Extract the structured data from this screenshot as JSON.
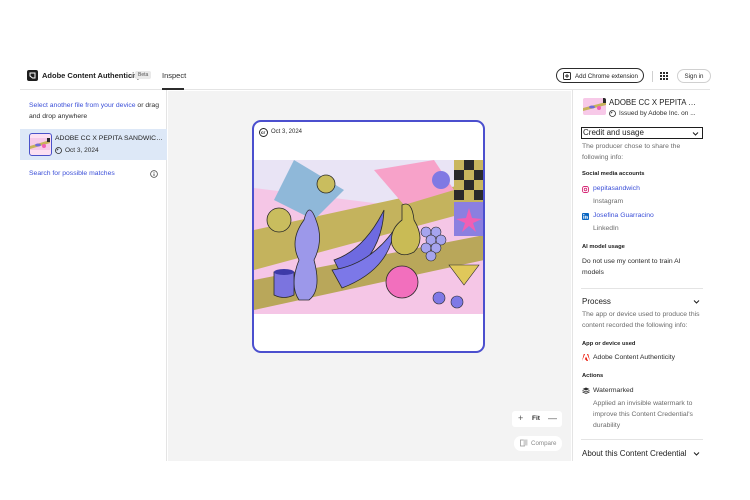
{
  "header": {
    "app_title": "Adobe Content Authenticity",
    "beta_badge": "Beta",
    "tab_inspect": "Inspect",
    "extension_button": "Add Chrome extension",
    "signin_button": "Sign in"
  },
  "left_panel": {
    "drop_link": "Select another file from your device",
    "drop_text": " or drag and drop anywhere",
    "file": {
      "name": "ADOBE CC X PEPITA SANDWICH...",
      "date": "Oct 3, 2024"
    },
    "search_matches": "Search for possible matches"
  },
  "canvas": {
    "credential_date": "Oct 3, 2024",
    "zoom_fit": "Fit",
    "zoom_in": "+",
    "zoom_out": "—",
    "compare_label": "Compare"
  },
  "right_panel": {
    "title": "ADOBE CC X PEPITA SA...",
    "issued_by": "Issued by Adobe Inc. on ...",
    "credit": {
      "heading": "Credit and usage",
      "description": "The producer chose to share the following info:",
      "social_label": "Social media accounts",
      "accounts": [
        {
          "handle": "pepitasandwich",
          "platform": "Instagram",
          "icon": "instagram-icon"
        },
        {
          "handle": "Josefina Guarracino",
          "platform": "LinkedIn",
          "icon": "linkedin-icon"
        }
      ],
      "ai_label": "AI model usage",
      "ai_text": "Do not use my content to train AI models"
    },
    "process": {
      "heading": "Process",
      "description": "The app or device used to produce this content recorded the following info:",
      "app_label": "App or device used",
      "app_name": "Adobe Content Authenticity",
      "actions_label": "Actions",
      "action_name": "Watermarked",
      "action_desc": "Applied an invisible watermark to improve this Content Credential's durability"
    },
    "about": {
      "heading": "About this Content Credential"
    }
  },
  "colors": {
    "accent": "#3b4fd8",
    "frame": "#4b4fce",
    "selected_row": "#dde8f7"
  }
}
